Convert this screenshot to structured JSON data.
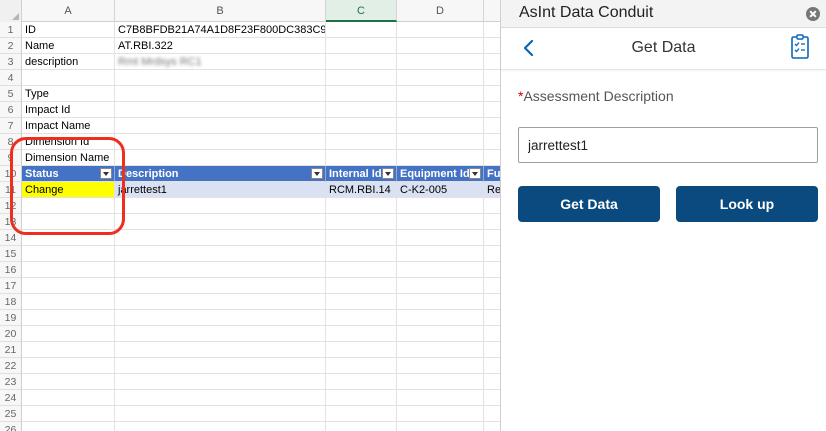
{
  "sheet": {
    "columns": [
      "A",
      "B",
      "C",
      "D"
    ],
    "rows": [
      {
        "num": "1",
        "a": "ID",
        "b": "C7B8BFDB21A74A1D8F23F800DC383C98"
      },
      {
        "num": "2",
        "a": "Name",
        "b": "AT.RBI.322"
      },
      {
        "num": "3",
        "a": "description",
        "b": "Rmt Mrdsys RC1"
      },
      {
        "num": "4",
        "a": "",
        "b": ""
      },
      {
        "num": "5",
        "a": "Type",
        "b": ""
      },
      {
        "num": "6",
        "a": "Impact Id",
        "b": ""
      },
      {
        "num": "7",
        "a": "Impact Name",
        "b": ""
      },
      {
        "num": "8",
        "a": "Dimension Id",
        "b": ""
      },
      {
        "num": "9",
        "a": "Dimension Name",
        "b": ""
      }
    ],
    "table": {
      "row_num": "10",
      "headers": [
        "Status",
        "Description",
        "Internal Id",
        "Equipment Id",
        "Fu"
      ],
      "data_row_num": "11",
      "data": [
        "Change",
        "jarrettest1",
        "RCM.RBI.14",
        "C-K2-005",
        "Re"
      ]
    },
    "empty_rows": [
      "12",
      "13",
      "14",
      "15",
      "16",
      "17",
      "18",
      "19",
      "20",
      "21",
      "22",
      "23",
      "24",
      "25",
      "26"
    ]
  },
  "pane": {
    "window_title": "AsInt Data Conduit",
    "header_title": "Get Data",
    "field_required_mark": "*",
    "field_label": "Assessment Description",
    "field_value": "jarrettest1",
    "get_data_label": "Get Data",
    "lookup_label": "Look up"
  },
  "colors": {
    "accent": "#0a4a7f",
    "table_header": "#4472c4",
    "highlight": "#ffff00",
    "annotation": "#f02e1f"
  },
  "icons": [
    "back-chevron-icon",
    "checklist-icon",
    "close-icon"
  ]
}
